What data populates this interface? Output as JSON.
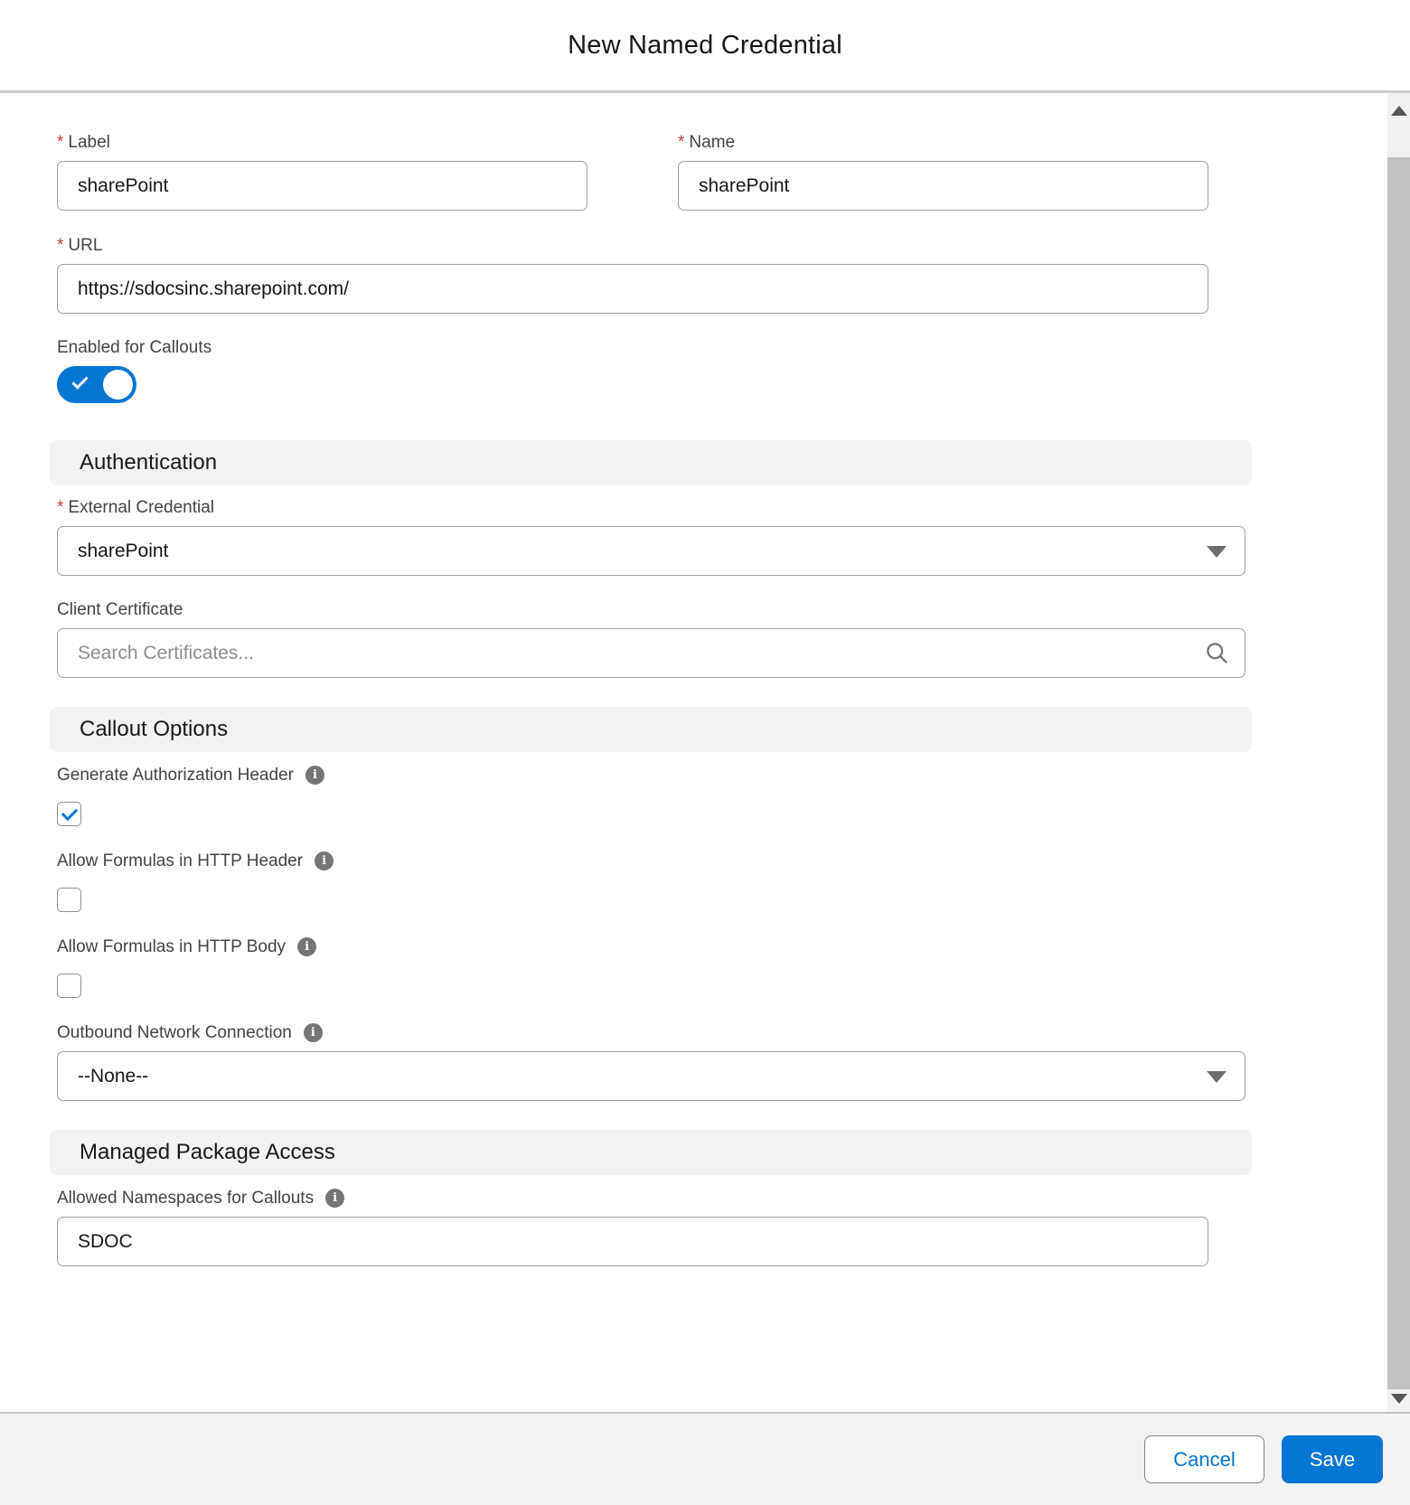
{
  "title": "New Named Credential",
  "ui": {
    "required_marker": "*"
  },
  "icons": {
    "info_glyph": "i",
    "search": "search-icon",
    "dropdown": "chevron-down-icon"
  },
  "colors": {
    "brand_blue": "#0176d3",
    "required_red": "#c23934",
    "section_bg": "#f3f2f2",
    "footer_bg": "#f3f2f2"
  },
  "form": {
    "label_field": {
      "label": "Label",
      "value": "sharePoint",
      "required": true
    },
    "name_field": {
      "label": "Name",
      "value": "sharePoint",
      "required": true
    },
    "url_field": {
      "label": "URL",
      "value": "https://sdocsinc.sharepoint.com/",
      "required": true
    },
    "enabled_for_callouts": {
      "label": "Enabled for Callouts",
      "state": "on"
    }
  },
  "authentication": {
    "heading": "Authentication",
    "external_credential": {
      "label": "External Credential",
      "value": "sharePoint",
      "required": true
    },
    "client_certificate": {
      "label": "Client Certificate",
      "placeholder": "Search Certificates..."
    }
  },
  "callout_options": {
    "heading": "Callout Options",
    "generate_authorization_header": {
      "label": "Generate Authorization Header",
      "checked": true
    },
    "allow_formulas_http_header": {
      "label": "Allow Formulas in HTTP Header",
      "checked": false
    },
    "allow_formulas_http_body": {
      "label": "Allow Formulas in HTTP Body",
      "checked": false
    },
    "outbound_network_connection": {
      "label": "Outbound Network Connection",
      "value": "--None--"
    }
  },
  "managed_package_access": {
    "heading": "Managed Package Access",
    "allowed_namespaces": {
      "label": "Allowed Namespaces for Callouts",
      "value": "SDOC"
    }
  },
  "footer": {
    "cancel_label": "Cancel",
    "save_label": "Save"
  }
}
